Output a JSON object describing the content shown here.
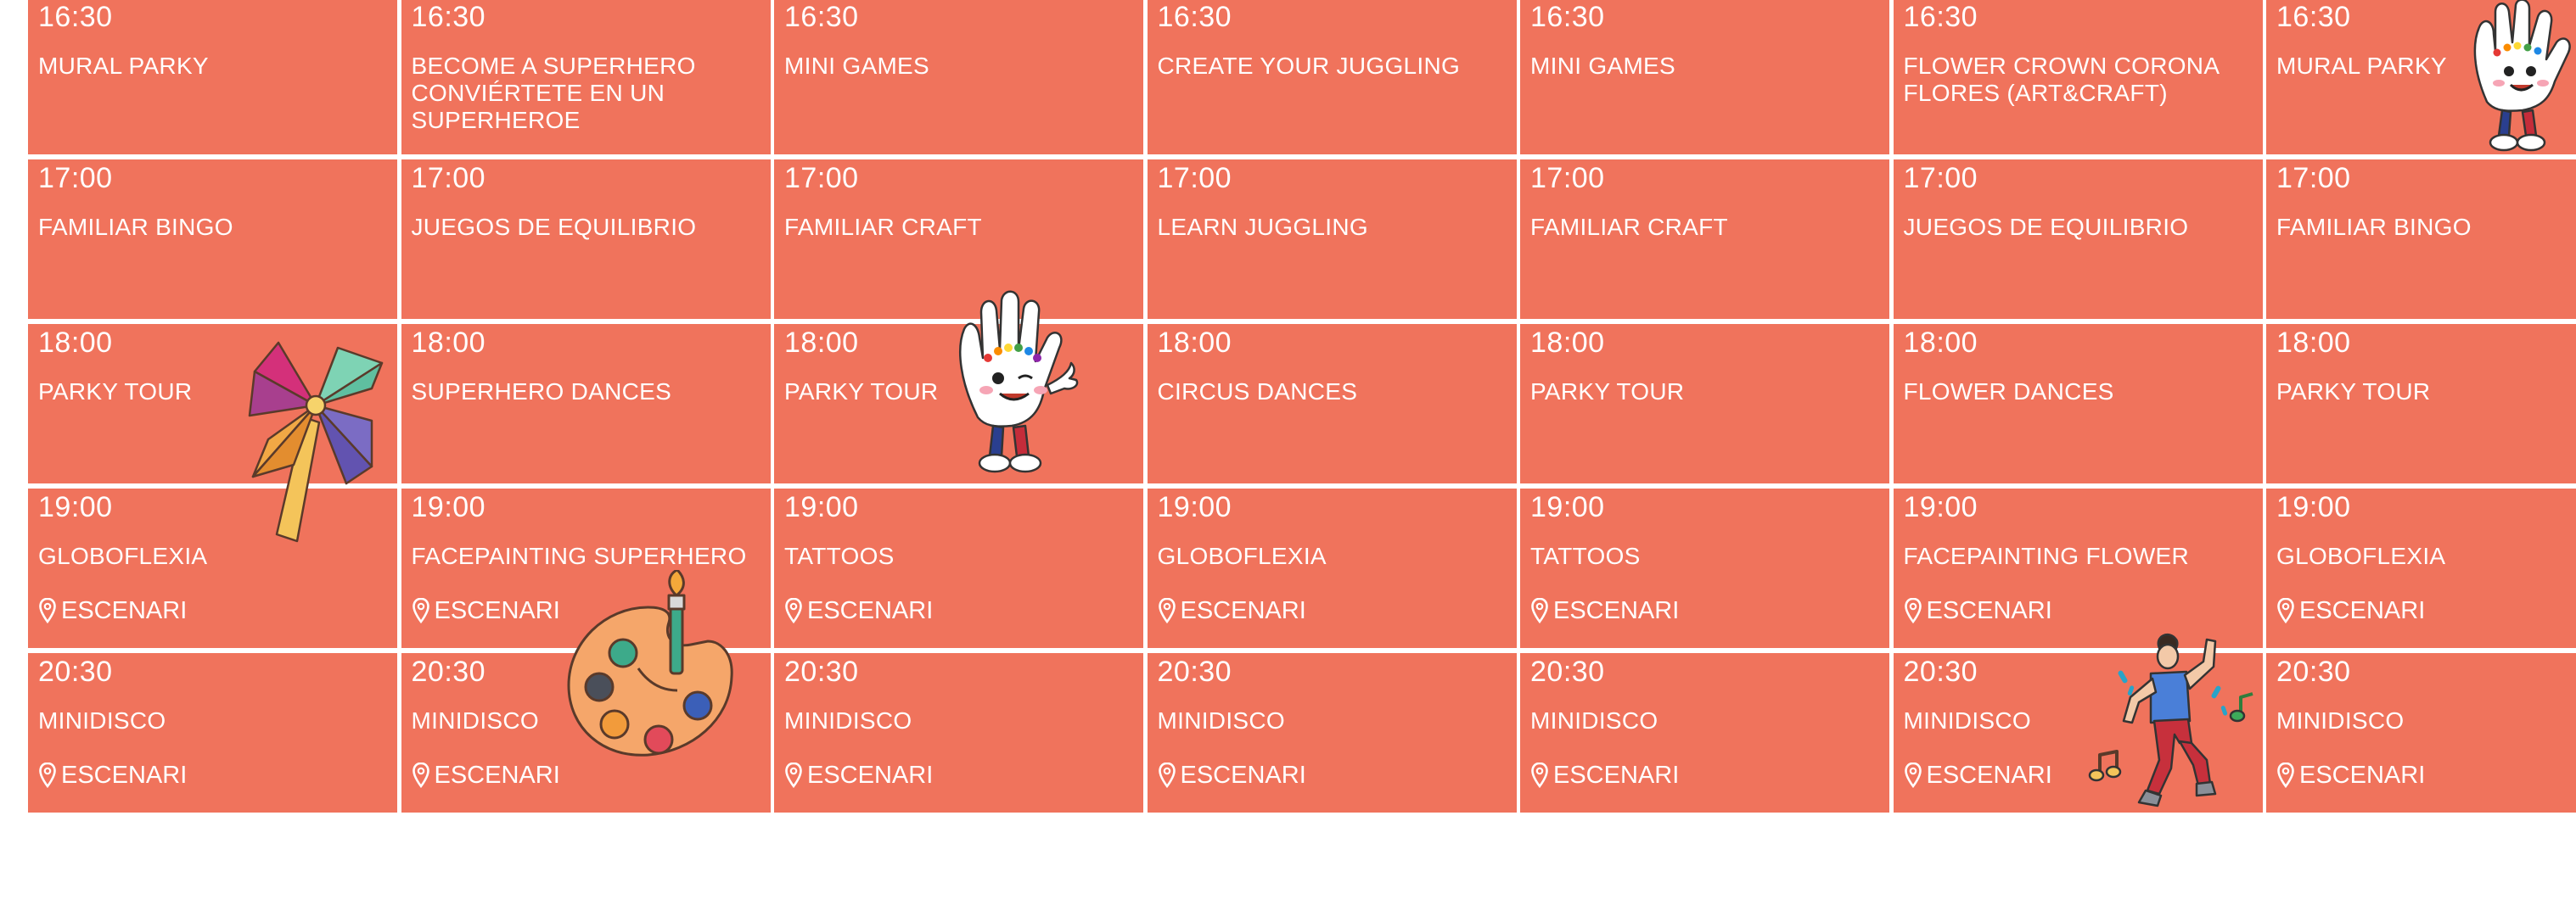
{
  "schedule": {
    "rows": [
      {
        "time": "16:30",
        "activities": [
          {
            "title": "MURAL PARKY"
          },
          {
            "title": "BECOME A SUPERHERO CONVIÉRTETE EN UN SUPERHEROE"
          },
          {
            "title": "MINI GAMES"
          },
          {
            "title": "CREATE YOUR JUGGLING"
          },
          {
            "title": "MINI GAMES"
          },
          {
            "title": "FLOWER CROWN CORONA FLORES (ART&CRAFT)"
          },
          {
            "title": "MURAL PARKY"
          }
        ]
      },
      {
        "time": "17:00",
        "activities": [
          {
            "title": "FAMILIAR BINGO"
          },
          {
            "title": "JUEGOS DE EQUILIBRIO"
          },
          {
            "title": "FAMILIAR CRAFT"
          },
          {
            "title": "LEARN JUGGLING"
          },
          {
            "title": "FAMILIAR CRAFT"
          },
          {
            "title": "JUEGOS DE EQUILIBRIO"
          },
          {
            "title": "FAMILIAR BINGO"
          }
        ]
      },
      {
        "time": "18:00",
        "activities": [
          {
            "title": "PARKY TOUR"
          },
          {
            "title": "SUPERHERO DANCES"
          },
          {
            "title": "PARKY TOUR"
          },
          {
            "title": "CIRCUS DANCES"
          },
          {
            "title": "PARKY TOUR"
          },
          {
            "title": "FLOWER DANCES"
          },
          {
            "title": "PARKY TOUR"
          }
        ]
      },
      {
        "time": "19:00",
        "activities": [
          {
            "title": "GLOBOFLEXIA",
            "location": "ESCENARI"
          },
          {
            "title": "FACEPAINTING SUPERHERO",
            "location": "ESCENARI"
          },
          {
            "title": "TATTOOS",
            "location": "ESCENARI"
          },
          {
            "title": "GLOBOFLEXIA",
            "location": "ESCENARI"
          },
          {
            "title": "TATTOOS",
            "location": "ESCENARI"
          },
          {
            "title": "FACEPAINTING FLOWER",
            "location": "ESCENARI"
          },
          {
            "title": "GLOBOFLEXIA",
            "location": "ESCENARI"
          }
        ]
      },
      {
        "time": "20:30",
        "activities": [
          {
            "title": "MINIDISCO",
            "location": "ESCENARI"
          },
          {
            "title": "MINIDISCO",
            "location": "ESCENARI"
          },
          {
            "title": "MINIDISCO",
            "location": "ESCENARI"
          },
          {
            "title": "MINIDISCO",
            "location": "ESCENARI"
          },
          {
            "title": "MINIDISCO",
            "location": "ESCENARI"
          },
          {
            "title": "MINIDISCO",
            "location": "ESCENARI"
          },
          {
            "title": "MINIDISCO",
            "location": "ESCENARI"
          }
        ]
      }
    ]
  },
  "colors": {
    "cell_background": "#f0735c",
    "text": "#ffffff",
    "gridlines": "#ffffff"
  },
  "decorations": [
    "pinwheel-illustration",
    "glove-mascot-illustration",
    "paint-palette-illustration",
    "dancer-illustration"
  ]
}
